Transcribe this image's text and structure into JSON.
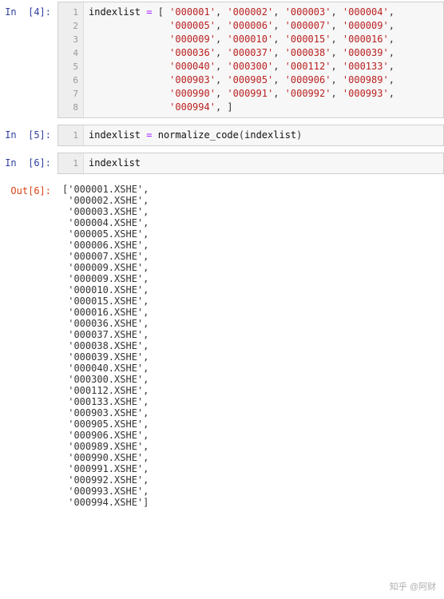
{
  "cells": [
    {
      "type": "in",
      "n": 4,
      "lines": 8,
      "code_tokens": [
        {
          "t": "indexlist",
          "c": "tok-var"
        },
        {
          "t": " ",
          "c": ""
        },
        {
          "t": "=",
          "c": "tok-op"
        },
        {
          "t": " [ ",
          "c": "tok-punc"
        },
        {
          "t": "'000001'",
          "c": "tok-str"
        },
        {
          "t": ", ",
          "c": "tok-punc"
        },
        {
          "t": "'000002'",
          "c": "tok-str"
        },
        {
          "t": ", ",
          "c": "tok-punc"
        },
        {
          "t": "'000003'",
          "c": "tok-str"
        },
        {
          "t": ", ",
          "c": "tok-punc"
        },
        {
          "t": "'000004'",
          "c": "tok-str"
        },
        {
          "t": ",\n",
          "c": "tok-punc"
        },
        {
          "t": "              ",
          "c": ""
        },
        {
          "t": "'000005'",
          "c": "tok-str"
        },
        {
          "t": ", ",
          "c": "tok-punc"
        },
        {
          "t": "'000006'",
          "c": "tok-str"
        },
        {
          "t": ", ",
          "c": "tok-punc"
        },
        {
          "t": "'000007'",
          "c": "tok-str"
        },
        {
          "t": ", ",
          "c": "tok-punc"
        },
        {
          "t": "'000009'",
          "c": "tok-str"
        },
        {
          "t": ",\n",
          "c": "tok-punc"
        },
        {
          "t": "              ",
          "c": ""
        },
        {
          "t": "'000009'",
          "c": "tok-str"
        },
        {
          "t": ", ",
          "c": "tok-punc"
        },
        {
          "t": "'000010'",
          "c": "tok-str"
        },
        {
          "t": ", ",
          "c": "tok-punc"
        },
        {
          "t": "'000015'",
          "c": "tok-str"
        },
        {
          "t": ", ",
          "c": "tok-punc"
        },
        {
          "t": "'000016'",
          "c": "tok-str"
        },
        {
          "t": ",\n",
          "c": "tok-punc"
        },
        {
          "t": "              ",
          "c": ""
        },
        {
          "t": "'000036'",
          "c": "tok-str"
        },
        {
          "t": ", ",
          "c": "tok-punc"
        },
        {
          "t": "'000037'",
          "c": "tok-str"
        },
        {
          "t": ", ",
          "c": "tok-punc"
        },
        {
          "t": "'000038'",
          "c": "tok-str"
        },
        {
          "t": ", ",
          "c": "tok-punc"
        },
        {
          "t": "'000039'",
          "c": "tok-str"
        },
        {
          "t": ",\n",
          "c": "tok-punc"
        },
        {
          "t": "              ",
          "c": ""
        },
        {
          "t": "'000040'",
          "c": "tok-str"
        },
        {
          "t": ", ",
          "c": "tok-punc"
        },
        {
          "t": "'000300'",
          "c": "tok-str"
        },
        {
          "t": ", ",
          "c": "tok-punc"
        },
        {
          "t": "'000112'",
          "c": "tok-str"
        },
        {
          "t": ", ",
          "c": "tok-punc"
        },
        {
          "t": "'000133'",
          "c": "tok-str"
        },
        {
          "t": ",\n",
          "c": "tok-punc"
        },
        {
          "t": "              ",
          "c": ""
        },
        {
          "t": "'000903'",
          "c": "tok-str"
        },
        {
          "t": ", ",
          "c": "tok-punc"
        },
        {
          "t": "'000905'",
          "c": "tok-str"
        },
        {
          "t": ", ",
          "c": "tok-punc"
        },
        {
          "t": "'000906'",
          "c": "tok-str"
        },
        {
          "t": ", ",
          "c": "tok-punc"
        },
        {
          "t": "'000989'",
          "c": "tok-str"
        },
        {
          "t": ",\n",
          "c": "tok-punc"
        },
        {
          "t": "              ",
          "c": ""
        },
        {
          "t": "'000990'",
          "c": "tok-str"
        },
        {
          "t": ", ",
          "c": "tok-punc"
        },
        {
          "t": "'000991'",
          "c": "tok-str"
        },
        {
          "t": ", ",
          "c": "tok-punc"
        },
        {
          "t": "'000992'",
          "c": "tok-str"
        },
        {
          "t": ", ",
          "c": "tok-punc"
        },
        {
          "t": "'000993'",
          "c": "tok-str"
        },
        {
          "t": ",\n",
          "c": "tok-punc"
        },
        {
          "t": "              ",
          "c": ""
        },
        {
          "t": "'000994'",
          "c": "tok-str"
        },
        {
          "t": ", ]",
          "c": "tok-punc"
        }
      ]
    },
    {
      "type": "in",
      "n": 5,
      "lines": 1,
      "code_tokens": [
        {
          "t": "indexlist",
          "c": "tok-var"
        },
        {
          "t": " ",
          "c": ""
        },
        {
          "t": "=",
          "c": "tok-op"
        },
        {
          "t": " ",
          "c": ""
        },
        {
          "t": "normalize_code",
          "c": "tok-func"
        },
        {
          "t": "(",
          "c": "tok-punc"
        },
        {
          "t": "indexlist",
          "c": "tok-var"
        },
        {
          "t": ")",
          "c": "tok-punc"
        }
      ]
    },
    {
      "type": "in",
      "n": 6,
      "lines": 1,
      "code_tokens": [
        {
          "t": "indexlist",
          "c": "tok-var"
        }
      ]
    },
    {
      "type": "out",
      "n": 6,
      "output_list": [
        "000001.XSHE",
        "000002.XSHE",
        "000003.XSHE",
        "000004.XSHE",
        "000005.XSHE",
        "000006.XSHE",
        "000007.XSHE",
        "000009.XSHE",
        "000009.XSHE",
        "000010.XSHE",
        "000015.XSHE",
        "000016.XSHE",
        "000036.XSHE",
        "000037.XSHE",
        "000038.XSHE",
        "000039.XSHE",
        "000040.XSHE",
        "000300.XSHE",
        "000112.XSHE",
        "000133.XSHE",
        "000903.XSHE",
        "000905.XSHE",
        "000906.XSHE",
        "000989.XSHE",
        "000990.XSHE",
        "000991.XSHE",
        "000992.XSHE",
        "000993.XSHE",
        "000994.XSHE"
      ]
    }
  ],
  "watermark": "知乎 @阿财"
}
